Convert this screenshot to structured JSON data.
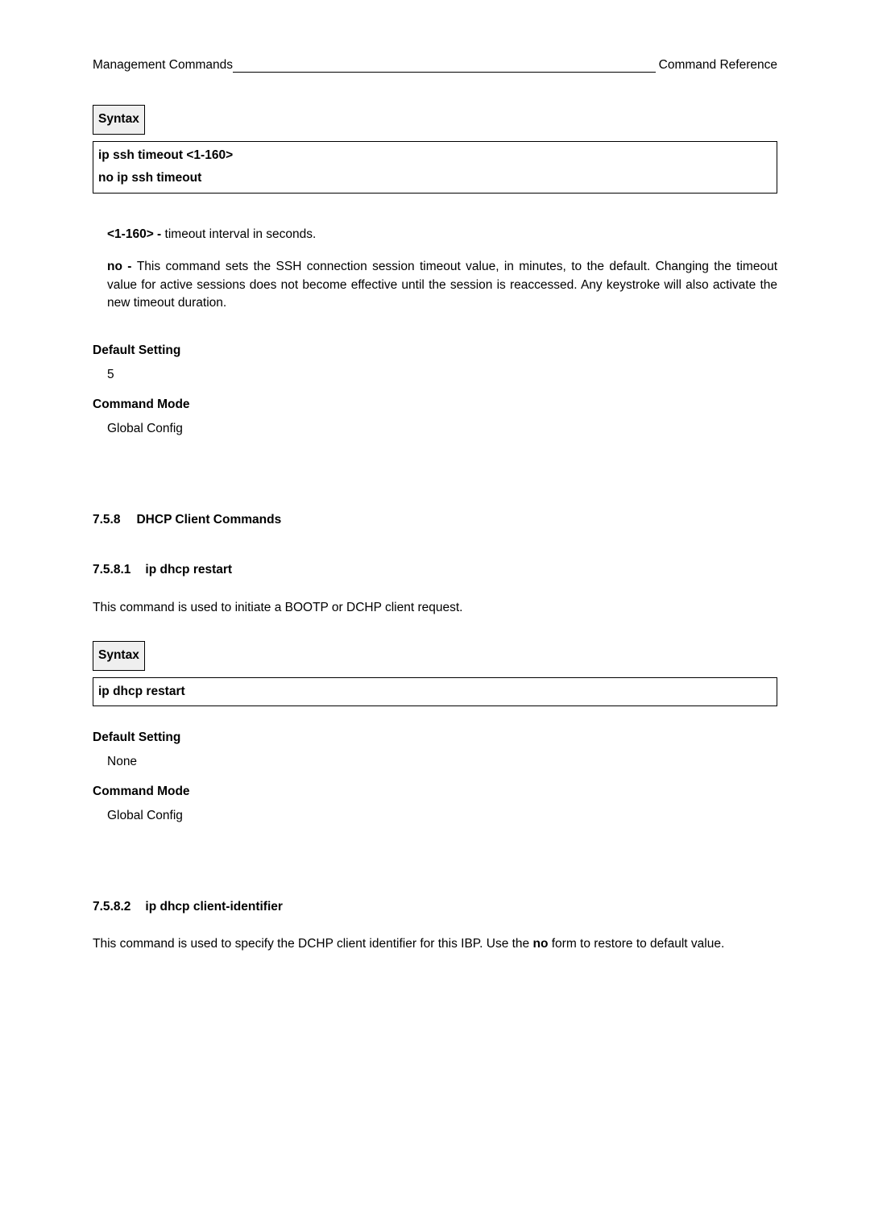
{
  "header": {
    "left": "Management Commands",
    "right": "Command Reference"
  },
  "syntax_label": "Syntax",
  "box1": {
    "line1": "ip ssh timeout <1-160>",
    "line2": "no ip ssh timeout"
  },
  "param1": {
    "label": "<1-160> - ",
    "text": "timeout interval in seconds."
  },
  "param2": {
    "label": "no - ",
    "text": "This command sets the SSH connection session timeout value, in minutes, to the default. Changing the timeout value for active sessions does not become effective until the session is reaccessed. Any keystroke will also activate the new timeout duration."
  },
  "default_setting_label": "Default Setting",
  "default_setting_value_1": "5",
  "command_mode_label": "Command Mode",
  "command_mode_value": "Global Config",
  "sec758": {
    "num": "7.5.8",
    "title": "DHCP Client Commands"
  },
  "sec7581": {
    "num": "7.5.8.1",
    "title": "ip dhcp restart",
    "desc": "This command is used to initiate a BOOTP or DCHP client request."
  },
  "box2": {
    "line1": "ip dhcp restart"
  },
  "default_setting_value_2": "None",
  "sec7582": {
    "num": "7.5.8.2",
    "title": "ip dhcp client-identifier",
    "desc_pre": "This command is used to specify the DCHP client identifier for this IBP. Use the ",
    "desc_bold": "no",
    "desc_post": " form to restore to default value."
  }
}
